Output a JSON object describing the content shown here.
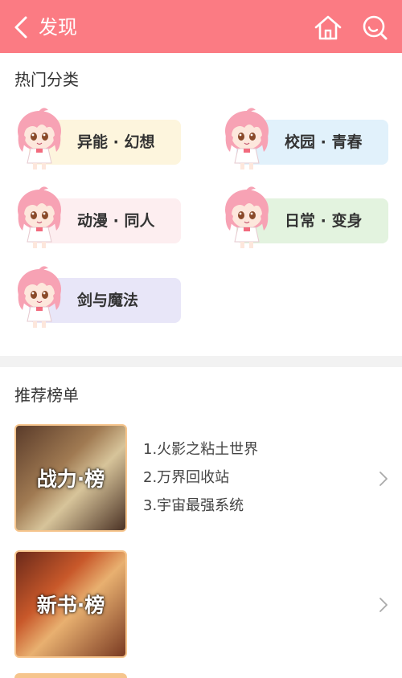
{
  "header": {
    "back_icon": "chevron-left-icon",
    "title": "发现",
    "home_icon": "home-icon",
    "search_icon": "search-icon",
    "bg_color": "#fb7b83"
  },
  "categories": {
    "title": "热门分类",
    "items": [
      {
        "label": "异能 · 幻想",
        "color": "#fdf5dd"
      },
      {
        "label": "校园 · 青春",
        "color": "#e1f1fb"
      },
      {
        "label": "动漫 · 同人",
        "color": "#fdeef0"
      },
      {
        "label": "日常 · 变身",
        "color": "#e3f3df"
      },
      {
        "label": "剑与魔法",
        "color": "#e8e6f8"
      }
    ]
  },
  "rankings": {
    "title": "推荐榜单",
    "items": [
      {
        "cover_text": "战力·榜",
        "books": [
          "1.火影之粘土世界",
          "2.万界回收站",
          "3.宇宙最强系统"
        ]
      },
      {
        "cover_text": "新书·榜",
        "books": []
      }
    ]
  }
}
